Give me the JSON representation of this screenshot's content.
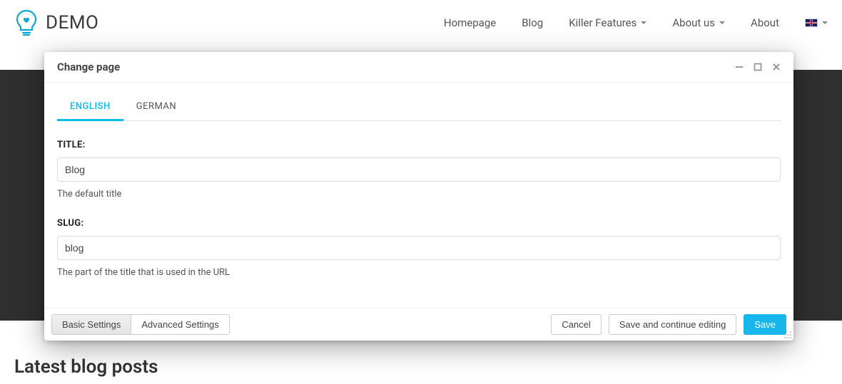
{
  "header": {
    "brand": "DEMO",
    "nav": [
      {
        "label": "Homepage",
        "dropdown": false
      },
      {
        "label": "Blog",
        "dropdown": false
      },
      {
        "label": "Killer Features",
        "dropdown": true
      },
      {
        "label": "About us",
        "dropdown": true
      },
      {
        "label": "About",
        "dropdown": false
      }
    ],
    "language": "en-gb"
  },
  "page": {
    "heading": "Latest blog posts"
  },
  "modal": {
    "title": "Change page",
    "language_tabs": [
      {
        "label": "ENGLISH",
        "active": true
      },
      {
        "label": "GERMAN",
        "active": false
      }
    ],
    "fields": {
      "title": {
        "label": "TITLE:",
        "value": "Blog",
        "help": "The default title"
      },
      "slug": {
        "label": "SLUG:",
        "value": "blog",
        "help": "The part of the title that is used in the URL"
      }
    },
    "footer_tabs": [
      {
        "label": "Basic Settings",
        "active": true
      },
      {
        "label": "Advanced Settings",
        "active": false
      }
    ],
    "actions": {
      "cancel": "Cancel",
      "save_continue": "Save and continue editing",
      "save": "Save"
    }
  }
}
